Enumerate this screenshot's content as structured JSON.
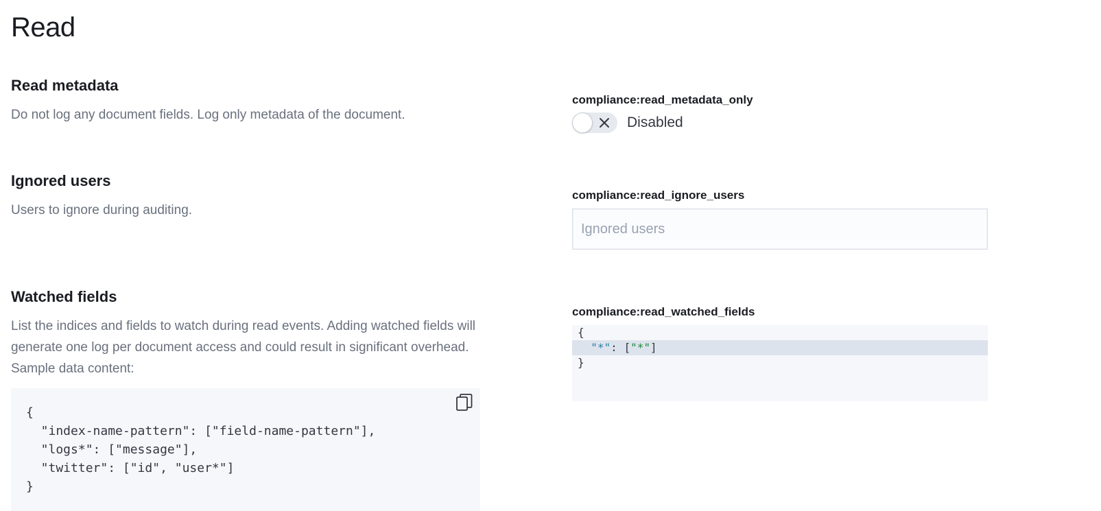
{
  "page": {
    "title": "Read"
  },
  "sections": {
    "read_metadata": {
      "title": "Read metadata",
      "description": "Do not log any document fields. Log only metadata of the document.",
      "field_label": "compliance:read_metadata_only",
      "switch_label": "Disabled",
      "switch_on": false
    },
    "ignored_users": {
      "title": "Ignored users",
      "description": "Users to ignore during auditing.",
      "field_label": "compliance:read_ignore_users",
      "input_value": "",
      "input_placeholder": "Ignored users"
    },
    "watched_fields": {
      "title": "Watched fields",
      "description": "List the indices and fields to watch during read events. Adding watched fields will generate one log per document access and could result in significant overhead. Sample data content:",
      "field_label": "compliance:read_watched_fields",
      "editor_lines": [
        {
          "text": "{"
        },
        {
          "key": "\"*\"",
          "sep": ": [",
          "str": "\"*\"",
          "end": "]"
        },
        {
          "text": "}"
        }
      ],
      "sample_code_lines": [
        "{",
        "  \"index-name-pattern\": [\"field-name-pattern\"],",
        "  \"logs*\": [\"message\"],",
        "  \"twitter\": [\"id\", \"user*\"]",
        "}"
      ]
    }
  },
  "icons": {
    "switch": "cross-icon",
    "copy": "copy-icon"
  },
  "colors": {
    "title_text": "#1a1c21",
    "description_text": "#69707d",
    "code_background": "#f5f7fa",
    "editor_active_line": "#dde3ec",
    "json_key": "#2a7ea8",
    "json_string": "#1e8a3a"
  }
}
